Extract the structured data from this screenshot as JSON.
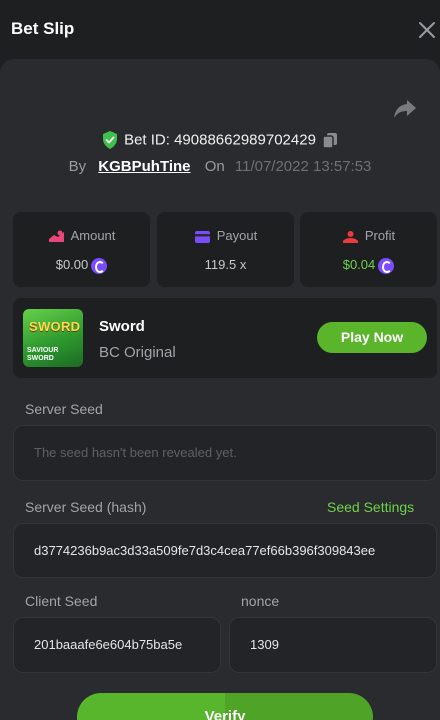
{
  "header": {
    "title": "Bet Slip"
  },
  "bet": {
    "id_label": "Bet ID:",
    "id": "49088662989702429",
    "by_label": "By",
    "user": "KGBPuhTine",
    "on_label": "On",
    "date": "11/07/2022 13:57:53"
  },
  "stats": {
    "amount": {
      "label": "Amount",
      "value": "$0.00"
    },
    "payout": {
      "label": "Payout",
      "value": "119.5 x"
    },
    "profit": {
      "label": "Profit",
      "value": "$0.04"
    }
  },
  "game": {
    "name": "Sword",
    "provider": "BC Original",
    "play_label": "Play Now",
    "thumb_title": "SWORD",
    "thumb_sub1": "SAVIOUR",
    "thumb_sub2": "SWORD"
  },
  "fairness": {
    "server_seed_label": "Server Seed",
    "server_seed_placeholder": "The seed hasn't been revealed yet.",
    "server_hash_label": "Server Seed (hash)",
    "seed_settings_label": "Seed Settings",
    "server_hash": "d3774236b9ac3d33a509fe7d3c4cea77ef66b396f309843ee",
    "client_seed_label": "Client Seed",
    "client_seed": "201baaafe6e604b75ba5e",
    "nonce_label": "nonce",
    "nonce": "1309"
  },
  "actions": {
    "verify_label": "Verify"
  },
  "colors": {
    "accent_green": "#5ab52b",
    "profit_green": "#6fd34a",
    "coin_purple": "#7b4cff",
    "amount_pink": "#e8467a",
    "payout_purple": "#7b4cff",
    "profit_red": "#e83b3b",
    "shield_green": "#3fc14b"
  }
}
